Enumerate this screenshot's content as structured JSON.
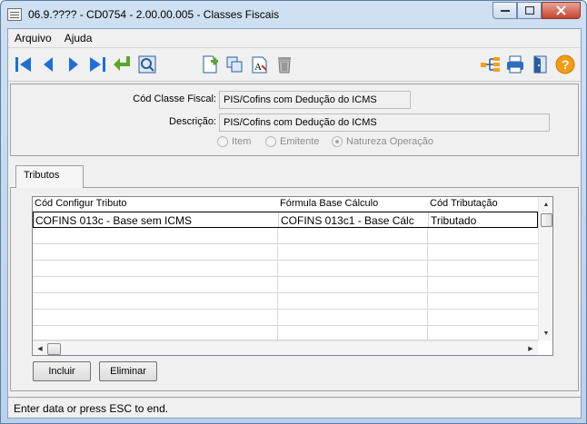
{
  "window": {
    "title": "06.9.???? - CD0754 - 2.00.00.005 - Classes Fiscais"
  },
  "menu": {
    "items": [
      {
        "label": "Arquivo"
      },
      {
        "label": "Ajuda"
      }
    ]
  },
  "form": {
    "classe_label": "Cód Classe Fiscal:",
    "classe_value": "PIS/Cofins com Dedução do ICMS",
    "descricao_label": "Descrição:",
    "descricao_value": "PIS/Cofins com Dedução do ICMS",
    "radios": [
      {
        "label": "Item"
      },
      {
        "label": "Emitente"
      },
      {
        "label": "Natureza Operação"
      }
    ]
  },
  "tabs": [
    {
      "label": "Tributos"
    }
  ],
  "grid": {
    "columns": [
      "Cód Configur Tributo",
      "Fórmula Base Cálculo",
      "Cód Tributação"
    ],
    "rows": [
      {
        "c1": "COFINS 013c - Base sem ICMS",
        "c2": "COFINS 013c1 - Base Cálc",
        "c3": "Tributado"
      }
    ]
  },
  "buttons": {
    "incluir": "Incluir",
    "eliminar": "Eliminar"
  },
  "status": {
    "text": "Enter data or press ESC to end."
  },
  "colors": {
    "accent": "#1f6fd6",
    "help": "#f39c12"
  }
}
